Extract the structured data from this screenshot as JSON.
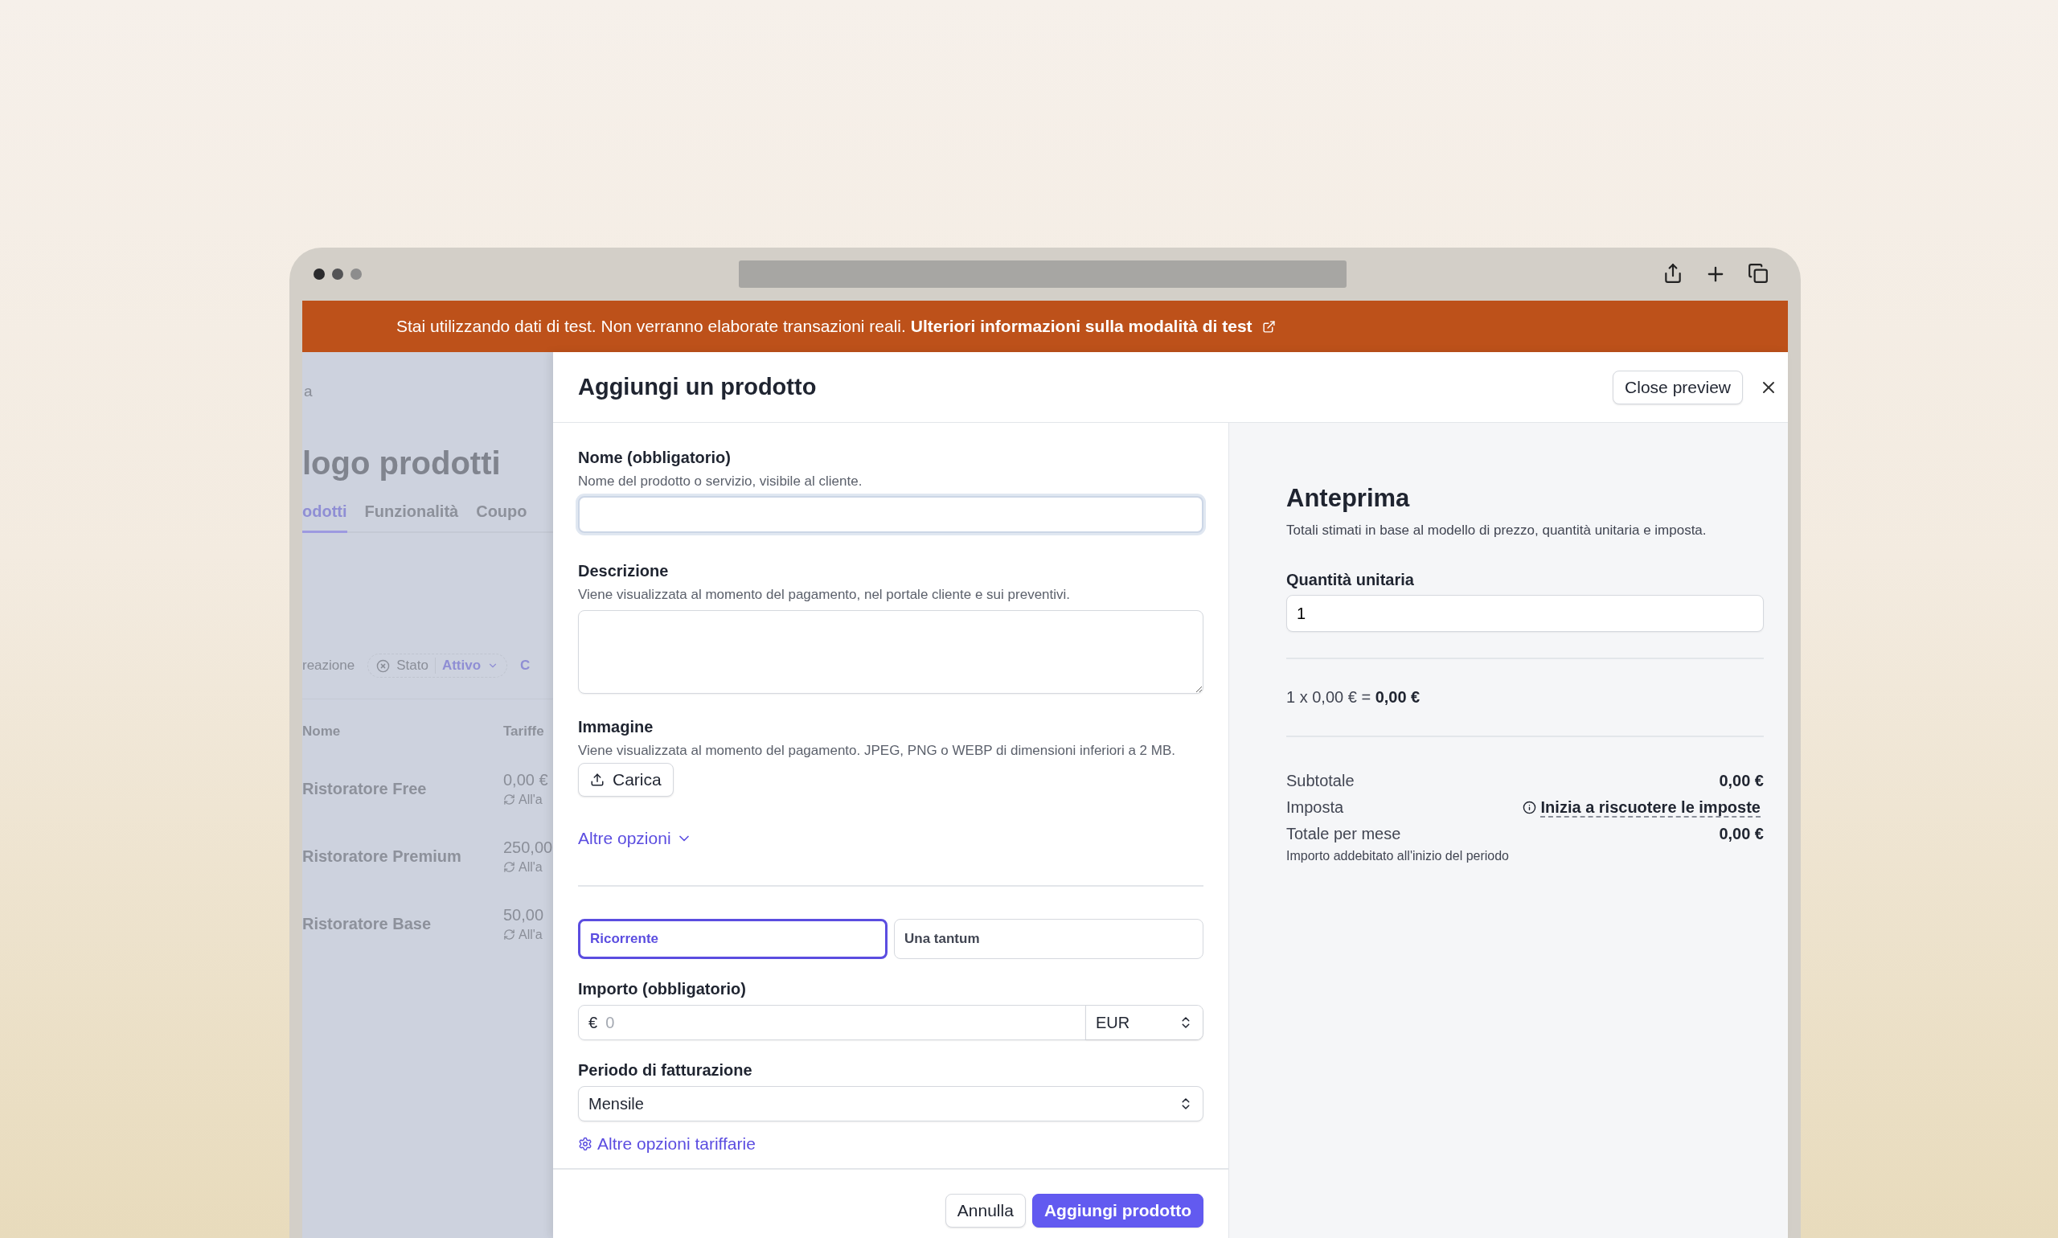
{
  "banner": {
    "text": "Stai utilizzando dati di test. Non verranno elaborate transazioni reali.",
    "link": "Ulteriori informazioni sulla modalità di test"
  },
  "background_page": {
    "breadcrumb": "a",
    "title": "logo prodotti",
    "tabs": [
      {
        "label": "odotti",
        "selected": true
      },
      {
        "label": "Funzionalità",
        "selected": false
      },
      {
        "label": "Coupo",
        "selected": false
      }
    ],
    "filters": {
      "column_1": "reazione",
      "chip_label": "Stato",
      "chip_value": "Attivo",
      "link": "C"
    },
    "columns": [
      "Nome",
      "Tariffe"
    ],
    "rows": [
      {
        "name": "Ristoratore Free",
        "price": "0,00 €",
        "interval": "All'a"
      },
      {
        "name": "Ristoratore Premium",
        "price": "250,00",
        "interval": "All'a"
      },
      {
        "name": "Ristoratore Base",
        "price": "50,00",
        "interval": "All'a"
      }
    ]
  },
  "modal": {
    "title": "Aggiungi un prodotto",
    "close_preview": "Close preview",
    "name_field": {
      "label": "Nome (obbligatorio)",
      "hint": "Nome del prodotto o servizio, visibile al cliente.",
      "focused": true
    },
    "description_field": {
      "label": "Descrizione",
      "hint": "Viene visualizzata al momento del pagamento, nel portale cliente e sui preventivi."
    },
    "image_field": {
      "label": "Immagine",
      "hint": "Viene visualizzata al momento del pagamento. JPEG, PNG o WEBP di dimensioni inferiori a 2 MB.",
      "button": "Carica"
    },
    "more_options": "Altre opzioni",
    "price_type": [
      {
        "label": "Ricorrente",
        "selected": true
      },
      {
        "label": "Una tantum",
        "selected": false
      }
    ],
    "amount": {
      "label": "Importo (obbligatorio)",
      "currency_symbol": "€",
      "placeholder": "0",
      "currency": "EUR"
    },
    "billing_period": {
      "label": "Periodo di fatturazione",
      "value": "Mensile"
    },
    "more_pricing_options": "Altre opzioni tariffarie",
    "buttons": [
      {
        "label": "Annulla",
        "kind": "secondary"
      },
      {
        "label": "Aggiungi prodotto",
        "kind": "primary"
      }
    ]
  },
  "preview": {
    "title": "Anteprima",
    "subtitle": "Totali stimati in base al modello di prezzo, quantità unitaria e imposta.",
    "quantity": {
      "label": "Quantità unitaria",
      "value": "1"
    },
    "calculation": "1 x 0,00 € = **0,00 €**",
    "summary": [
      {
        "label": "Subtotale",
        "value": "0,00 €",
        "kind": "value"
      },
      {
        "label": "Imposta",
        "value": "Inizia a riscuotere le imposte",
        "kind": "link"
      },
      {
        "label": "Totale per mese",
        "value": "0,00 €",
        "kind": "value"
      }
    ],
    "note": "Importo addebitato all'inizio del periodo"
  }
}
